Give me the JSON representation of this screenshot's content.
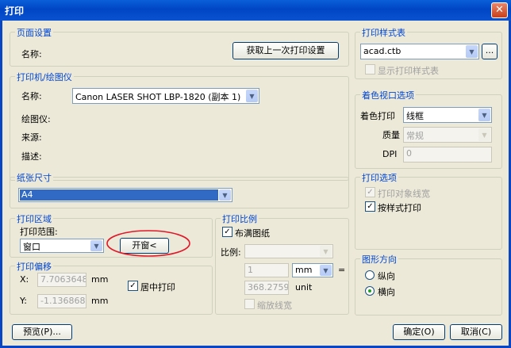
{
  "window": {
    "title": "打印",
    "close": "✕"
  },
  "page_setup": {
    "title": "页面设置",
    "name_label": "名称:",
    "get_last_button": "获取上一次打印设置"
  },
  "printer": {
    "title": "打印机/绘图仪",
    "name_label": "名称:",
    "name_value": "Canon LASER SHOT LBP-1820 (副本 1)",
    "plotter_label": "绘图仪:",
    "source_label": "来源:",
    "desc_label": "描述:"
  },
  "paper": {
    "title": "纸张尺寸",
    "value": "A4"
  },
  "print_area": {
    "title": "打印区域",
    "range_label": "打印范围:",
    "range_value": "窗口",
    "window_button": "开窗<"
  },
  "print_offset": {
    "title": "打印偏移",
    "x_label": "X:",
    "x_value": "7.7063648",
    "x_unit": "mm",
    "y_label": "Y:",
    "y_value": "-1.1368683",
    "y_unit": "mm",
    "center_label": "居中打印",
    "center_checked": true
  },
  "print_scale": {
    "title": "打印比例",
    "fit_label": "布满图纸",
    "fit_checked": true,
    "scale_label": "比例:",
    "value1": "1",
    "unit_value": "mm",
    "equals": "=",
    "value2": "368.2759",
    "unit2": "unit",
    "scale_lineweight": "缩放线宽"
  },
  "preview_button": "预览(P)...",
  "plot_style": {
    "title": "打印样式表",
    "value": "acad.ctb",
    "more": "...",
    "display_label": "显示打印样式表"
  },
  "shaded_viewport": {
    "title": "着色视口选项",
    "shade_label": "着色打印",
    "shade_value": "线框",
    "quality_label": "质量",
    "quality_value": "常规",
    "dpi_label": "DPI",
    "dpi_value": "0"
  },
  "print_options": {
    "title": "打印选项",
    "opt1": "打印对象线宽",
    "opt1_checked": true,
    "opt2": "按样式打印",
    "opt2_checked": true
  },
  "orientation": {
    "title": "图形方向",
    "portrait": "纵向",
    "landscape": "横向",
    "selected": "landscape"
  },
  "ok_button": "确定(O)",
  "cancel_button": "取消(C)",
  "colors": {
    "title_bar": "#0a52d0",
    "group_title": "#0046d5",
    "selection": "#316ac5",
    "highlight_circle": "#e0192a"
  }
}
